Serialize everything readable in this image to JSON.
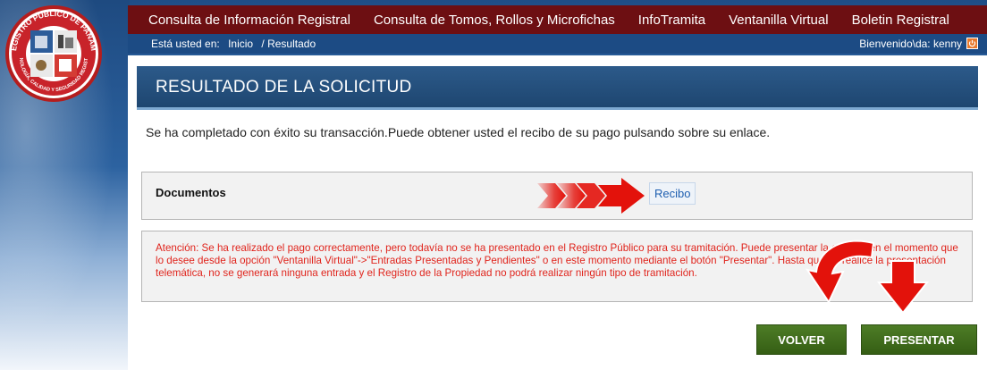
{
  "logo": {
    "ring_text": "REGISTRO PÚBLICO DE PANAMÁ",
    "motto": "TECNOLOGÍA, CALIDAD Y SEGURIDAD REGISTRAL"
  },
  "nav": {
    "items": [
      {
        "label": "Consulta de Información Registral"
      },
      {
        "label": "Consulta de Tomos, Rollos y Microfichas"
      },
      {
        "label": "InfoTramita"
      },
      {
        "label": "Ventanilla Virtual"
      },
      {
        "label": "Boletin Registral"
      }
    ]
  },
  "breadcrumb": {
    "prefix": "Está usted en:",
    "home": "Inicio",
    "current": "/ Resultado",
    "welcome": "Bienvenido\\da: kenny"
  },
  "result": {
    "title": "RESULTADO DE LA SOLICITUD",
    "message": "Se ha completado con éxito su transacción.Puede obtener usted el recibo de su pago pulsando sobre su enlace."
  },
  "documents": {
    "label": "Documentos",
    "link": "Recibo"
  },
  "warning": {
    "text": "Atención: Se ha realizado el pago correctamente, pero todavía no se ha presentado en el Registro Público para su tramitación. Puede presentar la entrada en el momento que lo desee desde la opción \"Ventanilla Virtual\"->\"Entradas Presentadas y Pendientes\" o en este momento mediante el botón \"Presentar\". Hasta que no realice la presentación telemática, no se generará ninguna entrada y el Registro de la Propiedad no podrá realizar ningún tipo de tramitación."
  },
  "buttons": {
    "volver": "VOLVER",
    "presentar": "PRESENTAR"
  },
  "colors": {
    "nav_bg": "#6d0f12",
    "crumb_bg": "#1c4b84",
    "header_bg": "#1e4670",
    "warning_text": "#e0241c",
    "button_green": "#3f6b1c",
    "arrow_red": "#e3120b"
  },
  "icons": {
    "logout": "power-icon",
    "pointer_arrows": "red-chevron-arrows",
    "callout_arrows": "red-curved-arrows"
  }
}
